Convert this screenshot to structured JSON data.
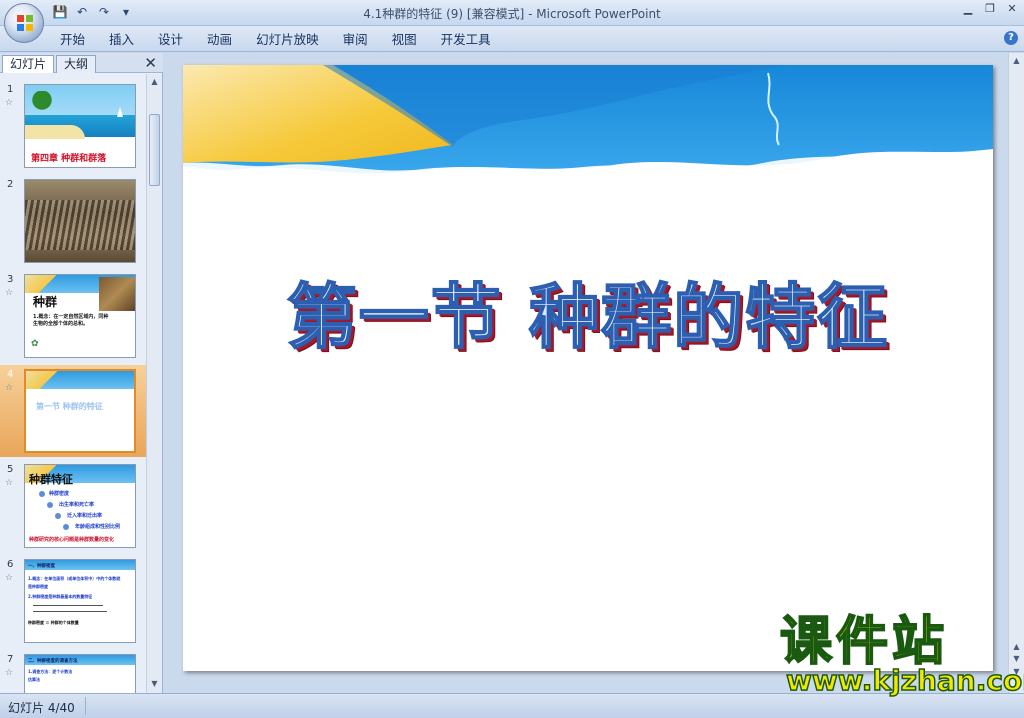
{
  "window": {
    "title": "4.1种群的特征 (9) [兼容模式] - Microsoft PowerPoint",
    "minimize": "▁",
    "restore": "❐",
    "close": "✕"
  },
  "qat": {
    "save": "💾",
    "undo": "↶",
    "redo": "↷",
    "more": "▾"
  },
  "ribbon": {
    "tabs": [
      "开始",
      "插入",
      "设计",
      "动画",
      "幻灯片放映",
      "审阅",
      "视图",
      "开发工具"
    ],
    "help": "?"
  },
  "panel": {
    "tabs": [
      "幻灯片",
      "大纲"
    ],
    "close": "✕",
    "selected_index": 3,
    "thumbnails": [
      {
        "num": "1",
        "star": "☆",
        "caption": "第四章  种群和群落"
      },
      {
        "num": "2",
        "star": ""
      },
      {
        "num": "3",
        "star": "☆",
        "heading": "种群",
        "body1": "1.概念：在一定自然区域内，同种",
        "body2": "生物的全部个体的总和。"
      },
      {
        "num": "4",
        "star": "☆",
        "caption": "第一节   种群的特征"
      },
      {
        "num": "5",
        "star": "☆",
        "heading": "种群特征",
        "items": [
          "种群密度",
          "出生率和死亡率",
          "迁入率和迁出率",
          "年龄组成和性别比例"
        ],
        "footer": "种群研究的核心问题是种群数量的变化"
      },
      {
        "num": "6",
        "star": "☆",
        "lines": [
          "一、种群密度",
          "1.概念：在单位面积（或单位体积中）中的个体数就",
          "是种群密度",
          "2.种群密度是种群最基本的数量特征",
          "种群密度 ＝ 种群的个体数量"
        ]
      },
      {
        "num": "7",
        "star": "☆",
        "lines": [
          "二、种群密度的调查方法",
          "1.调查方法：逐个计数法",
          "  估算法"
        ]
      }
    ]
  },
  "slide": {
    "title": "第一节    种群的特征"
  },
  "status": {
    "text": "幻灯片 4/40"
  },
  "watermark": {
    "main": "课件站",
    "url": "www.kjzhan.com"
  }
}
